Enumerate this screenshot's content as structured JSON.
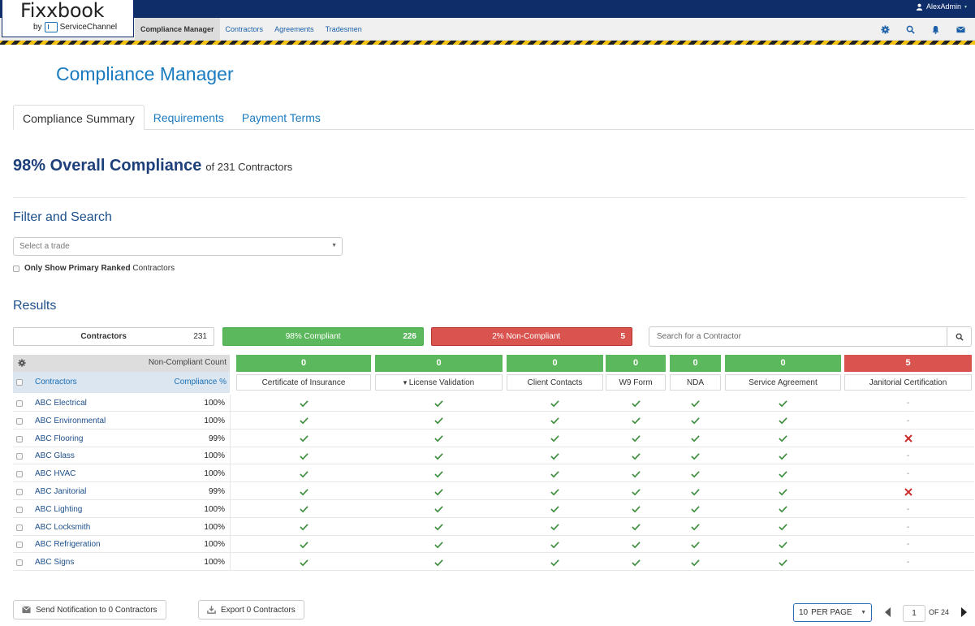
{
  "header": {
    "brand": "Fixxbook",
    "by": "by",
    "sub_brand": "ServiceChannel",
    "user": "AlexAdmin",
    "nav": [
      {
        "label": "Compliance Manager",
        "active": true
      },
      {
        "label": "Contractors",
        "active": false
      },
      {
        "label": "Agreements",
        "active": false
      },
      {
        "label": "Tradesmen",
        "active": false
      }
    ],
    "icons": [
      "gear-icon",
      "search-icon",
      "bell-icon",
      "envelope-icon"
    ]
  },
  "page": {
    "title": "Compliance Manager",
    "tabs": [
      "Compliance Summary",
      "Requirements",
      "Payment Terms"
    ],
    "active_tab": "Compliance Summary",
    "overall": {
      "big": "98% Overall Compliance",
      "of": "of 231 Contractors"
    }
  },
  "filter": {
    "heading": "Filter and Search",
    "trade_placeholder": "Select a trade",
    "primary_bold": "Only Show Primary Ranked",
    "primary_rest": "Contractors"
  },
  "results": {
    "heading": "Results",
    "contractors_label": "Contractors",
    "contractors_count": "231",
    "compliant_label": "98% Compliant",
    "compliant_count": "226",
    "noncompliant_label": "2% Non-Compliant",
    "noncompliant_count": "5",
    "search_placeholder": "Search for a Contractor"
  },
  "table": {
    "nc_count_label": "Non-Compliant Count",
    "col_contractors": "Contractors",
    "col_compliance": "Compliance %",
    "requirements": [
      {
        "name": "Certificate of Insurance",
        "count": "0",
        "status": "green",
        "sorted": false
      },
      {
        "name": "License Validation",
        "count": "0",
        "status": "green",
        "sorted": true
      },
      {
        "name": "Client Contacts",
        "count": "0",
        "status": "green",
        "sorted": false
      },
      {
        "name": "W9 Form",
        "count": "0",
        "status": "green",
        "sorted": false
      },
      {
        "name": "NDA",
        "count": "0",
        "status": "green",
        "sorted": false
      },
      {
        "name": "Service Agreement",
        "count": "0",
        "status": "green",
        "sorted": false
      },
      {
        "name": "Janitorial Certification",
        "count": "5",
        "status": "red",
        "sorted": false
      }
    ],
    "rows": [
      {
        "name": "ABC Electrical",
        "pct": "100%",
        "marks": [
          "check",
          "check",
          "check",
          "check",
          "check",
          "check",
          "dash"
        ]
      },
      {
        "name": "ABC Environmental",
        "pct": "100%",
        "marks": [
          "check",
          "check",
          "check",
          "check",
          "check",
          "check",
          "dash"
        ]
      },
      {
        "name": "ABC Flooring",
        "pct": "99%",
        "marks": [
          "check",
          "check",
          "check",
          "check",
          "check",
          "check",
          "x"
        ]
      },
      {
        "name": "ABC Glass",
        "pct": "100%",
        "marks": [
          "check",
          "check",
          "check",
          "check",
          "check",
          "check",
          "dash"
        ]
      },
      {
        "name": "ABC HVAC",
        "pct": "100%",
        "marks": [
          "check",
          "check",
          "check",
          "check",
          "check",
          "check",
          "dash"
        ]
      },
      {
        "name": "ABC Janitorial",
        "pct": "99%",
        "marks": [
          "check",
          "check",
          "check",
          "check",
          "check",
          "check",
          "x"
        ]
      },
      {
        "name": "ABC Lighting",
        "pct": "100%",
        "marks": [
          "check",
          "check",
          "check",
          "check",
          "check",
          "check",
          "dash"
        ]
      },
      {
        "name": "ABC Locksmith",
        "pct": "100%",
        "marks": [
          "check",
          "check",
          "check",
          "check",
          "check",
          "check",
          "dash"
        ]
      },
      {
        "name": "ABC Refrigeration",
        "pct": "100%",
        "marks": [
          "check",
          "check",
          "check",
          "check",
          "check",
          "check",
          "dash"
        ]
      },
      {
        "name": "ABC Signs",
        "pct": "100%",
        "marks": [
          "check",
          "check",
          "check",
          "check",
          "check",
          "check",
          "dash"
        ]
      }
    ],
    "dash_text": "-"
  },
  "footer": {
    "send_label": "Send Notification to 0 Contractors",
    "export_label": "Export 0 Contractors",
    "per_page": "10",
    "per_page_label": "PER PAGE",
    "page": "1",
    "of_pages": "OF 24"
  },
  "colors": {
    "navy": "#0f2d69",
    "link": "#1a7bc0",
    "green": "#5cb85c",
    "red": "#d9534f"
  }
}
